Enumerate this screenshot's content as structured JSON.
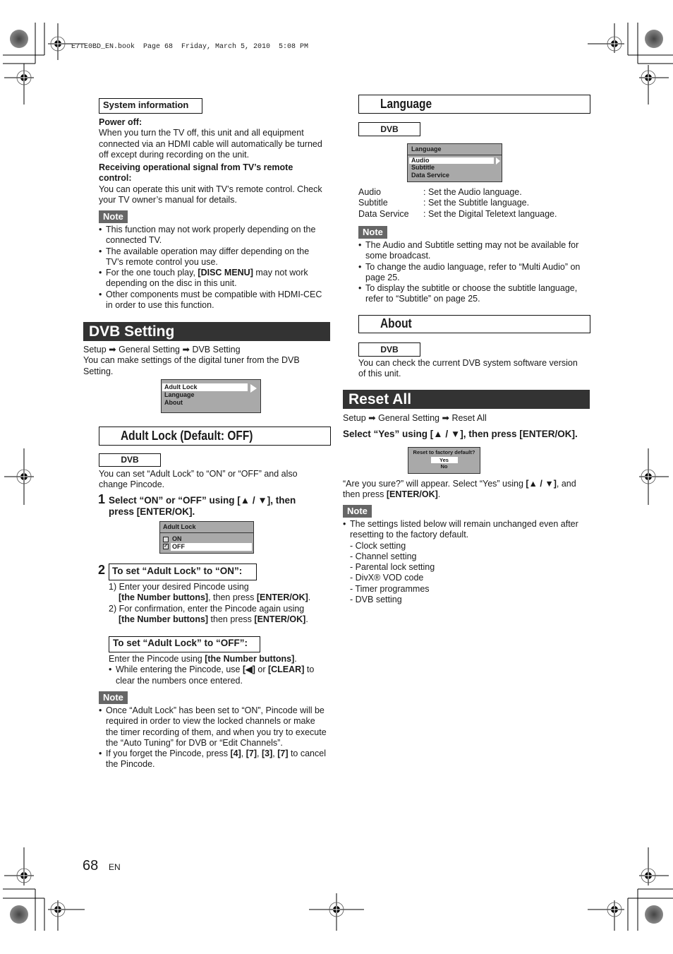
{
  "header": {
    "file_line": "E7TE0BD_EN.book  Page 68  Friday, March 5, 2010  5:08 PM"
  },
  "system_info": {
    "title": "System information",
    "power_off_label": "Power off:",
    "power_off_text": [
      "When you turn the TV off, this unit and all equipment",
      "connected via an HDMI cable will automatically be turned",
      "off except during recording on the unit."
    ],
    "receiving_label": [
      "Receiving operational signal from TV’s remote",
      "control:"
    ],
    "receiving_text": [
      "You can operate this unit with TV’s remote control. Check",
      "your TV owner’s manual for details."
    ],
    "note_label": "Note",
    "notes": [
      [
        "This function may not work properly depending on the",
        "connected TV."
      ],
      [
        "The available operation may differ depending on the",
        "TV’s remote control you use."
      ],
      [
        "For the one touch play, ",
        "[DISC MENU]",
        " may not work",
        "depending on the disc in this unit."
      ],
      [
        "Other components must be compatible with HDMI-CEC",
        "in order to use this function."
      ]
    ]
  },
  "dvb_setting": {
    "title": "DVB Setting",
    "breadcrumb": [
      "Setup",
      "General Setting",
      "DVB Setting"
    ],
    "intro": [
      "You can make settings of the digital tuner from the DVB",
      "Setting."
    ],
    "menu": [
      "Adult Lock",
      "Language",
      "About"
    ]
  },
  "adult_lock": {
    "title": "Adult Lock (Default: OFF)",
    "tag": "DVB",
    "intro": [
      "You can set “Adult Lock” to “ON” or “OFF” and also",
      "change Pincode."
    ],
    "step1_num": "1",
    "step1": [
      "Select “ON” or “OFF” using [▲ / ▼], then",
      "press [ENTER/OK]."
    ],
    "osd_title": "Adult Lock",
    "osd_options": [
      {
        "label": "ON",
        "checked": false
      },
      {
        "label": "OFF",
        "checked": true
      }
    ],
    "step2_num": "2",
    "on_title": "To set “Adult Lock” to “ON”:",
    "on_steps": [
      {
        "num": "1)",
        "line1": "Enter your desired Pincode using",
        "b1": "[the Number buttons]",
        "mid": ", then press ",
        "b2": "[ENTER/OK]",
        "end": "."
      },
      {
        "num": "2)",
        "line1": "For confirmation, enter the Pincode again using",
        "b1": "[the Number buttons]",
        "mid": " then press ",
        "b2": "[ENTER/OK]",
        "end": "."
      }
    ],
    "off_title": "To set “Adult Lock” to “OFF”:",
    "off_text_pre": "Enter the Pincode using ",
    "off_text_b": "[the Number buttons]",
    "off_text_end": ".",
    "off_bullet": [
      "While entering the Pincode, use ",
      "[◀]",
      " or ",
      "[CLEAR]",
      " to",
      "clear the numbers once entered."
    ],
    "note_label": "Note",
    "notes": [
      [
        "Once “Adult Lock” has been set to “ON”, Pincode will be",
        "required in order to view the locked channels or make",
        "the timer recording of them, and when you try to execute",
        "the “Auto Tuning” for DVB or “Edit Channels”."
      ],
      [
        "If you forget the Pincode, press ",
        "[4]",
        ", ",
        "[7]",
        ", ",
        "[3]",
        ", ",
        "[7]",
        " to cancel",
        "the Pincode."
      ]
    ]
  },
  "language": {
    "title": "Language",
    "tag": "DVB",
    "osd_title": "Language",
    "osd_items": [
      "Audio",
      "Subtitle",
      "Data Service"
    ],
    "defs": [
      {
        "term": "Audio",
        "desc": ": Set the Audio language."
      },
      {
        "term": "Subtitle",
        "desc": ": Set the Subtitle language."
      },
      {
        "term": "Data Service",
        "desc": ": Set the Digital Teletext language."
      }
    ],
    "note_label": "Note",
    "notes": [
      [
        "The Audio and Subtitle setting may not be available for",
        "some broadcast."
      ],
      [
        "To change the audio language, refer to “Multi Audio” on",
        "page 25."
      ],
      [
        "To display the subtitle or choose the subtitle language,",
        "refer to “Subtitle” on page 25."
      ]
    ]
  },
  "about": {
    "title": "About",
    "tag": "DVB",
    "text": [
      "You can check the current DVB system software version",
      "of this unit."
    ]
  },
  "reset_all": {
    "title": "Reset All",
    "breadcrumb": [
      "Setup",
      "General Setting",
      "Reset All"
    ],
    "instruction": "Select “Yes” using [▲ / ▼], then press [ENTER/OK].",
    "osd_title": "Reset to factory default?",
    "osd_options": [
      "Yes",
      "No"
    ],
    "confirm_pre": "“Are you sure?” will appear. Select “Yes” using ",
    "confirm_b1": "[▲ / ▼]",
    "confirm_mid": ", and",
    "confirm_line2_pre": "then press ",
    "confirm_b2": "[ENTER/OK]",
    "confirm_end": ".",
    "note_label": "Note",
    "note_intro": [
      "The settings listed below will remain unchanged even after",
      "resetting to the factory default."
    ],
    "kept_settings": [
      "Clock setting",
      "Channel setting",
      "Parental lock setting",
      "DivX® VOD code",
      "Timer programmes",
      "DVB setting"
    ]
  },
  "footer": {
    "page_number": "68",
    "lang": "EN"
  }
}
